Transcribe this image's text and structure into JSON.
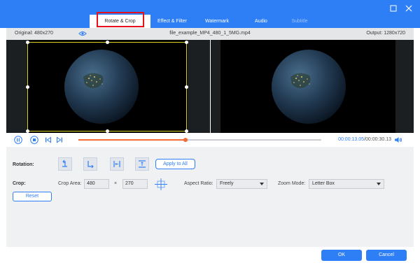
{
  "tabs": [
    {
      "label": "Rotate & Crop",
      "state": "active"
    },
    {
      "label": "Effect & Filter",
      "state": "normal"
    },
    {
      "label": "Watermark",
      "state": "normal"
    },
    {
      "label": "Audio",
      "state": "normal"
    },
    {
      "label": "Subtitle",
      "state": "disabled"
    }
  ],
  "window": {
    "minimize_icon": "minimize-icon",
    "close_icon": "close-icon"
  },
  "info": {
    "original": "Original: 480x270",
    "filename": "file_example_MP4_480_1_5MG.mp4",
    "output": "Output: 1280x720"
  },
  "player": {
    "current_time": "00:00:13.05",
    "total_time": "/00:00:30.13",
    "progress": 0.44
  },
  "rotation": {
    "label": "Rotation:",
    "apply_all": "Apply to All"
  },
  "crop": {
    "label": "Crop:",
    "area_label": "Crop Area:",
    "width": "480",
    "times": "×",
    "height": "270",
    "aspect_label": "Aspect Ratio:",
    "aspect_value": "Freely",
    "zoom_label": "Zoom Mode:",
    "zoom_value": "Letter Box",
    "reset": "Reset"
  },
  "footer": {
    "ok": "OK",
    "cancel": "Cancel"
  },
  "colors": {
    "accent": "#2e7ef6",
    "progress": "#f26a36",
    "crop_border": "#d8cf22",
    "highlight": "#e5121b"
  }
}
